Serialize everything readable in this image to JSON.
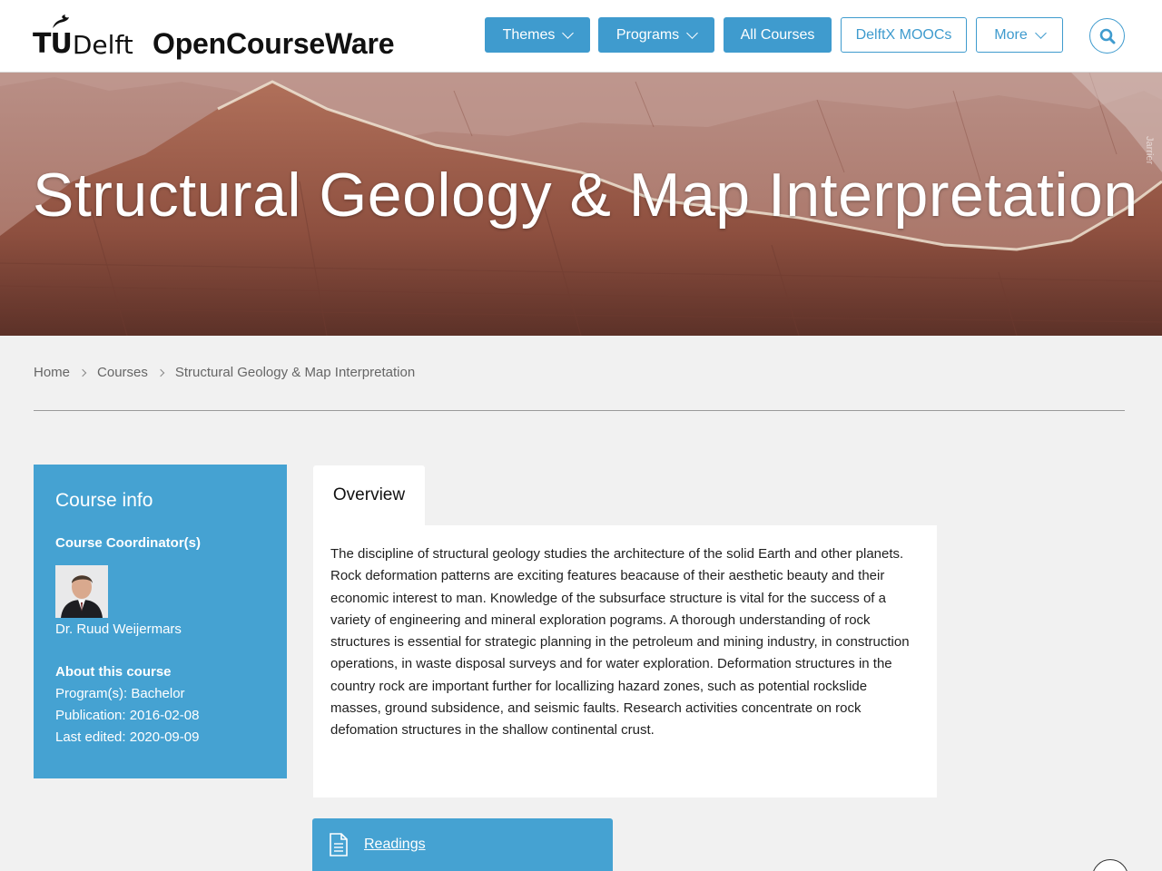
{
  "header": {
    "logo_tu": "TU",
    "logo_delft": "Delft",
    "site_title": "OpenCourseWare",
    "nav": {
      "themes": "Themes",
      "programs": "Programs",
      "all_courses": "All Courses",
      "delftx": "DelftX MOOCs",
      "more": "More"
    }
  },
  "hero": {
    "title": "Structural Geology & Map Interpretation",
    "credit": "Jarrier"
  },
  "breadcrumb": {
    "home": "Home",
    "courses": "Courses",
    "current": "Structural Geology & Map Interpretation"
  },
  "course_info": {
    "title": "Course info",
    "coordinators_heading": "Course Coordinator(s)",
    "coordinator_name": "Dr. Ruud Weijermars",
    "about_heading": "About this course",
    "program": "Program(s): Bachelor",
    "publication": "Publication: 2016-02-08",
    "last_edited": "Last edited: 2020-09-09"
  },
  "tabs": {
    "overview": "Overview"
  },
  "overview_text": "The discipline of structural geology studies the architecture of the solid Earth and other planets. Rock deformation patterns are exciting features beacause of their aesthetic beauty and their economic interest to man. Knowledge of the subsurface structure is vital for the success of a variety of engineering and mineral exploration pograms. A thorough understanding of rock structures is essential for strategic planning in the petroleum and mining industry, in construction operations, in waste disposal surveys and for water exploration. Deformation structures in the country rock are important further for locallizing hazard zones, such as potential rockslide masses, ground subsidence, and seismic faults. Research activities concentrate on rock defomation structures in the shallow continental crust.",
  "readings": {
    "label": "Readings"
  },
  "colors": {
    "accent": "#45a2d2",
    "button": "#3f9bce"
  }
}
